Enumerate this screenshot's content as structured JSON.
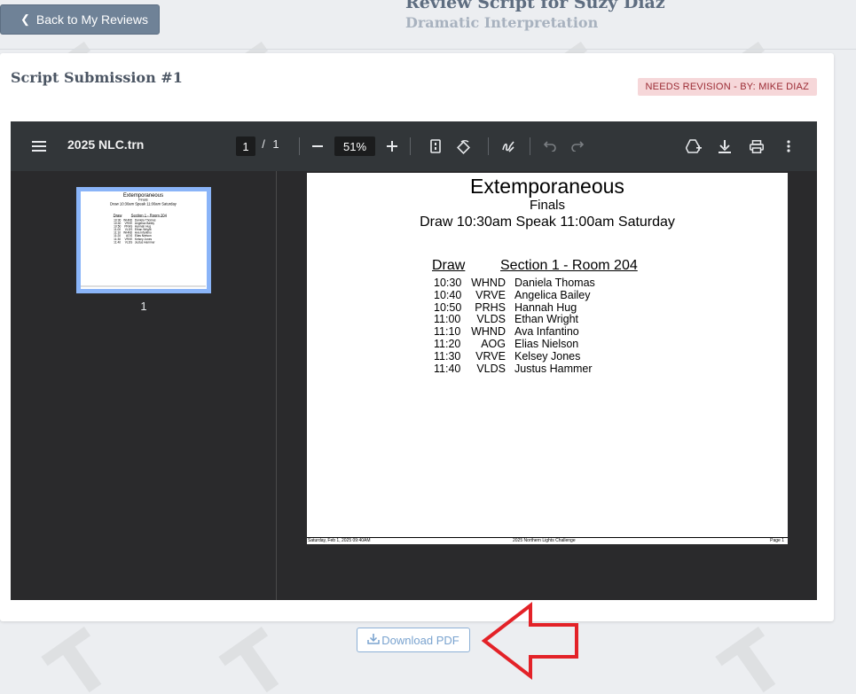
{
  "header": {
    "back_label": "Back to My Reviews",
    "title": "Review Script for Suzy Diaz",
    "subtitle": "Dramatic Interpretation"
  },
  "card": {
    "title": "Script Submission #1",
    "status_badge": "NEEDS REVISION - BY: MIKE DIAZ"
  },
  "viewer": {
    "file_name": "2025 NLC.trn",
    "page_current": "1",
    "page_sep": "/",
    "page_total": "1",
    "zoom": "51%",
    "thumb_label": "1"
  },
  "document": {
    "title": "Extemporaneous",
    "round": "Finals",
    "schedule": "Draw 10:30am  Speak 11:00am Saturday",
    "col_draw": "Draw",
    "col_section": "Section 1 - Room 204",
    "rows": [
      {
        "time": "10:30",
        "school": "WHND",
        "name": "Daniela Thomas"
      },
      {
        "time": "10:40",
        "school": "VRVE",
        "name": "Angelica Bailey"
      },
      {
        "time": "10:50",
        "school": "PRHS",
        "name": "Hannah Hug"
      },
      {
        "time": "11:00",
        "school": "VLDS",
        "name": "Ethan Wright"
      },
      {
        "time": "11:10",
        "school": "WHND",
        "name": "Ava Infantino"
      },
      {
        "time": "11:20",
        "school": "AOG",
        "name": "Elias Nielson"
      },
      {
        "time": "11:30",
        "school": "VRVE",
        "name": "Kelsey Jones"
      },
      {
        "time": "11:40",
        "school": "VLDS",
        "name": "Justus Hammer"
      }
    ],
    "footer_left": "Saturday, Feb 1, 2025 09:40AM",
    "footer_center": "2025 Northern Lights Challenge",
    "footer_right": "Page 1"
  },
  "download_label": "Download PDF",
  "icons": {
    "menu": "menu-icon",
    "zoom_out": "zoom-out-icon",
    "zoom_in": "zoom-in-icon",
    "fit_page": "fit-page-icon",
    "rotate": "rotate-icon",
    "annotate": "annotate-icon",
    "undo": "undo-icon",
    "redo": "redo-icon",
    "drive": "save-to-drive-icon",
    "download": "download-icon",
    "print": "print-icon",
    "more": "more-vert-icon"
  },
  "colors": {
    "back_button": "#6f8297",
    "badge_bg": "#f6d7d9",
    "badge_text": "#9b2b34",
    "viewer_toolbar": "#323639",
    "thumb_border": "#8ab4f8",
    "arrow": "#e32228"
  }
}
